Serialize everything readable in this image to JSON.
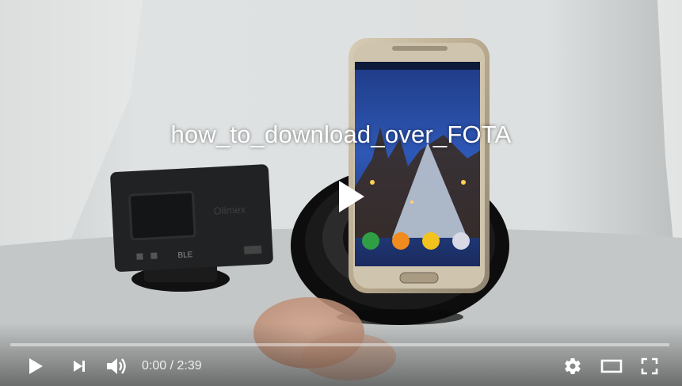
{
  "video": {
    "title": "how_to_download_over_FOTA",
    "played_fraction": 0.0
  },
  "controls": {
    "current_time": "0:00",
    "separator": " / ",
    "duration": "2:39"
  },
  "icons": {
    "big_play": "play-icon",
    "play": "play-icon",
    "next": "next-icon",
    "volume": "volume-icon",
    "settings": "gear-icon",
    "theater": "theater-mode-icon",
    "fullscreen": "fullscreen-icon"
  },
  "colors": {
    "progress_played": "#f12b24",
    "controls": "#ffffff"
  }
}
